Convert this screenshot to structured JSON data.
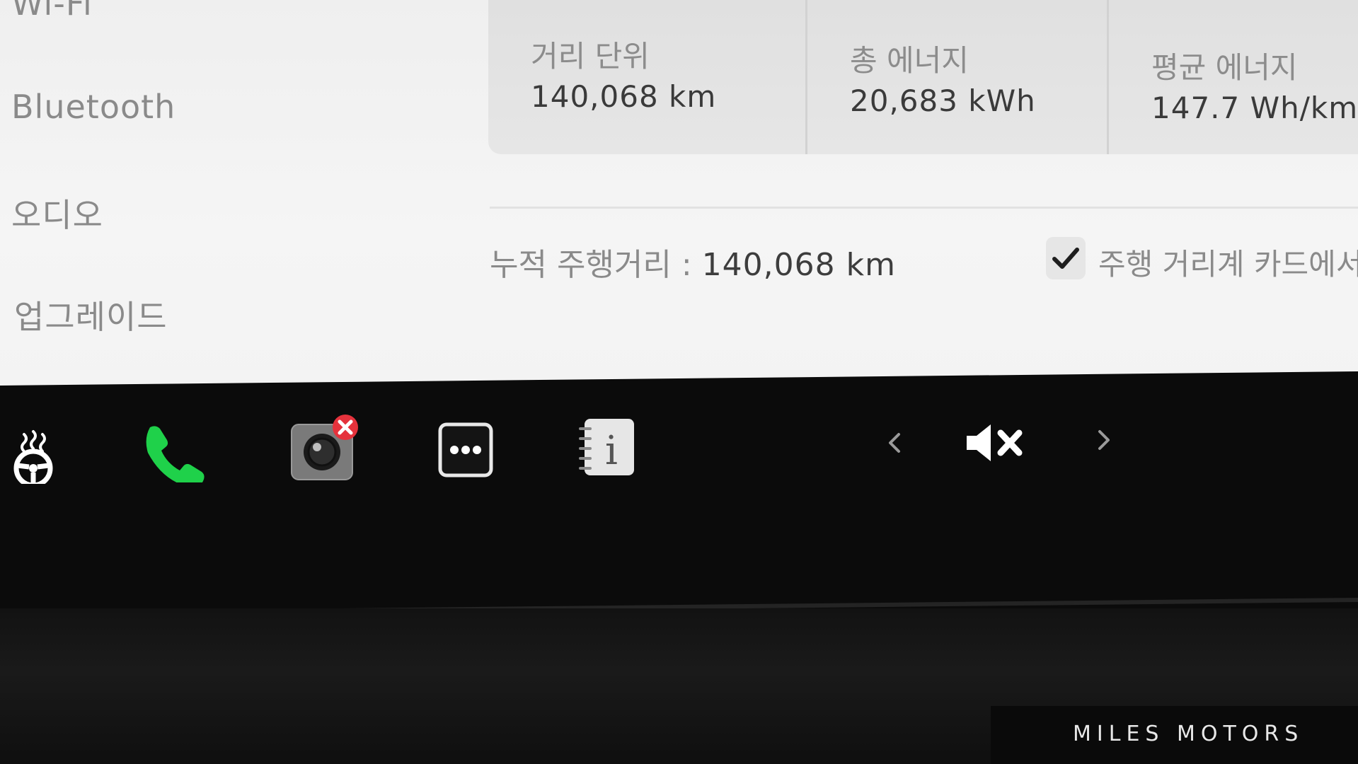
{
  "sidebar": {
    "items": [
      {
        "label": "Wi-Fi"
      },
      {
        "label": "Bluetooth"
      },
      {
        "label": "오디오"
      },
      {
        "label": "업그레이드"
      }
    ]
  },
  "stats": [
    {
      "label": "거리 단위",
      "value": "140,068 km"
    },
    {
      "label": "총 에너지",
      "value": "20,683 kWh"
    },
    {
      "label": "평균 에너지",
      "value": "147.7 Wh/km"
    }
  ],
  "odometer": {
    "label": "누적 주행거리 :",
    "value": "140,068 km"
  },
  "trip_card_option": {
    "checked": true,
    "label": "주행 거리계 카드에서 표"
  },
  "dock": {
    "icons": [
      "seat-heater-icon",
      "phone-icon",
      "camera-icon",
      "more-apps-icon",
      "manual-icon",
      "chevron-left-icon",
      "mute-icon",
      "chevron-right-icon"
    ],
    "colors": {
      "phone": "#1fd14a",
      "badge": "#e5323c"
    }
  },
  "watermark": {
    "text": "MILES MOTORS"
  }
}
